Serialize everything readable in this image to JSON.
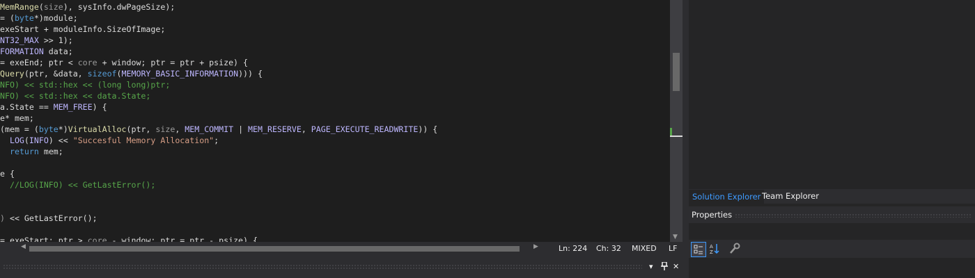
{
  "editor": {
    "lines": [
      [
        [
          "t-f",
          "MemRange"
        ],
        [
          "",
          "("
        ],
        [
          "t-p",
          "size"
        ],
        [
          "",
          "), sysInfo.dwPageSize);"
        ]
      ],
      [
        [
          "",
          "= ("
        ],
        [
          "t-k",
          "byte"
        ],
        [
          "",
          "*)module;"
        ]
      ],
      [
        [
          "",
          "exeStart + moduleInfo.SizeOfImage;"
        ]
      ],
      [
        [
          "t-m",
          "NT32_MAX"
        ],
        [
          "",
          " >> 1);"
        ]
      ],
      [
        [
          "t-m",
          "FORMATION"
        ],
        [
          "",
          " data;"
        ]
      ],
      [
        [
          "",
          "= exeEnd; ptr < "
        ],
        [
          "t-p",
          "core"
        ],
        [
          "",
          " + window; ptr = ptr + psize) {"
        ]
      ],
      [
        [
          "t-f",
          "Query"
        ],
        [
          "",
          "(ptr, &data, "
        ],
        [
          "t-k",
          "sizeof"
        ],
        [
          "",
          "("
        ],
        [
          "t-m",
          "MEMORY_BASIC_INFORMATION"
        ],
        [
          "",
          ")))"
        ],
        [
          "",
          " {"
        ]
      ],
      [
        [
          "t-c",
          "NFO) << std::hex << (long long)ptr;"
        ]
      ],
      [
        [
          "t-c",
          "NFO) << std::hex << data.State;"
        ]
      ],
      [
        [
          "",
          "a.State == "
        ],
        [
          "t-m",
          "MEM_FREE"
        ],
        [
          "",
          ") {"
        ]
      ],
      [
        [
          "",
          "e* mem;"
        ]
      ],
      [
        [
          "",
          "(mem = ("
        ],
        [
          "t-k",
          "byte"
        ],
        [
          "",
          "*)"
        ],
        [
          "t-f",
          "VirtualAlloc"
        ],
        [
          "",
          "(ptr, "
        ],
        [
          "t-p",
          "size"
        ],
        [
          "",
          ", "
        ],
        [
          "t-m",
          "MEM_COMMIT"
        ],
        [
          "",
          " | "
        ],
        [
          "t-m",
          "MEM_RESERVE"
        ],
        [
          "",
          ", "
        ],
        [
          "t-m",
          "PAGE_EXECUTE_READWRITE"
        ],
        [
          "",
          ")) {"
        ]
      ],
      [
        [
          "",
          "  "
        ],
        [
          "t-m",
          "LOG"
        ],
        [
          "",
          "("
        ],
        [
          "t-m",
          "INFO"
        ],
        [
          "",
          ") << "
        ],
        [
          "t-s",
          "\"Succesful Memory Allocation\""
        ],
        [
          "",
          ";"
        ]
      ],
      [
        [
          "",
          "  "
        ],
        [
          "t-k",
          "return"
        ],
        [
          "",
          " mem;"
        ]
      ],
      [
        [
          "",
          ""
        ]
      ],
      [
        [
          "",
          "e {"
        ]
      ],
      [
        [
          "",
          "  "
        ],
        [
          "t-c",
          "//LOG(INFO) << GetLastError();"
        ]
      ],
      [
        [
          "",
          ""
        ]
      ],
      [
        [
          "",
          ""
        ]
      ],
      [
        [
          "t-p",
          ")"
        ],
        [
          "",
          " << GetLastError();"
        ]
      ],
      [
        [
          "",
          ""
        ]
      ],
      [
        [
          "",
          "= exeStart; ptr > "
        ],
        [
          "t-p",
          "core"
        ],
        [
          "",
          " - window; ptr = ptr - psize) {"
        ]
      ]
    ]
  },
  "status": {
    "ln": "Ln: 224",
    "ch": "Ch: 32",
    "mode": "MIXED",
    "eol": "LF"
  },
  "bottom_panel": {
    "dropdown_glyph": "▾",
    "pin_glyph": "📌",
    "close_glyph": "✕"
  },
  "right_panel": {
    "tabs": [
      {
        "label": "Solution Explorer",
        "active": true
      },
      {
        "label": "Team Explorer",
        "active": false
      }
    ],
    "properties_title": "Properties",
    "toolbar_icons": [
      "categorized-icon",
      "alphabetical-icon",
      "property-pages-icon"
    ]
  },
  "colors": {
    "background": "#1e1e1e",
    "chrome": "#2d2d30",
    "accent": "#3e9bff",
    "comment": "#57a64a",
    "keyword": "#569cd6",
    "string": "#d69d85",
    "macro": "#beb7ff",
    "function": "#dcdcaa"
  }
}
